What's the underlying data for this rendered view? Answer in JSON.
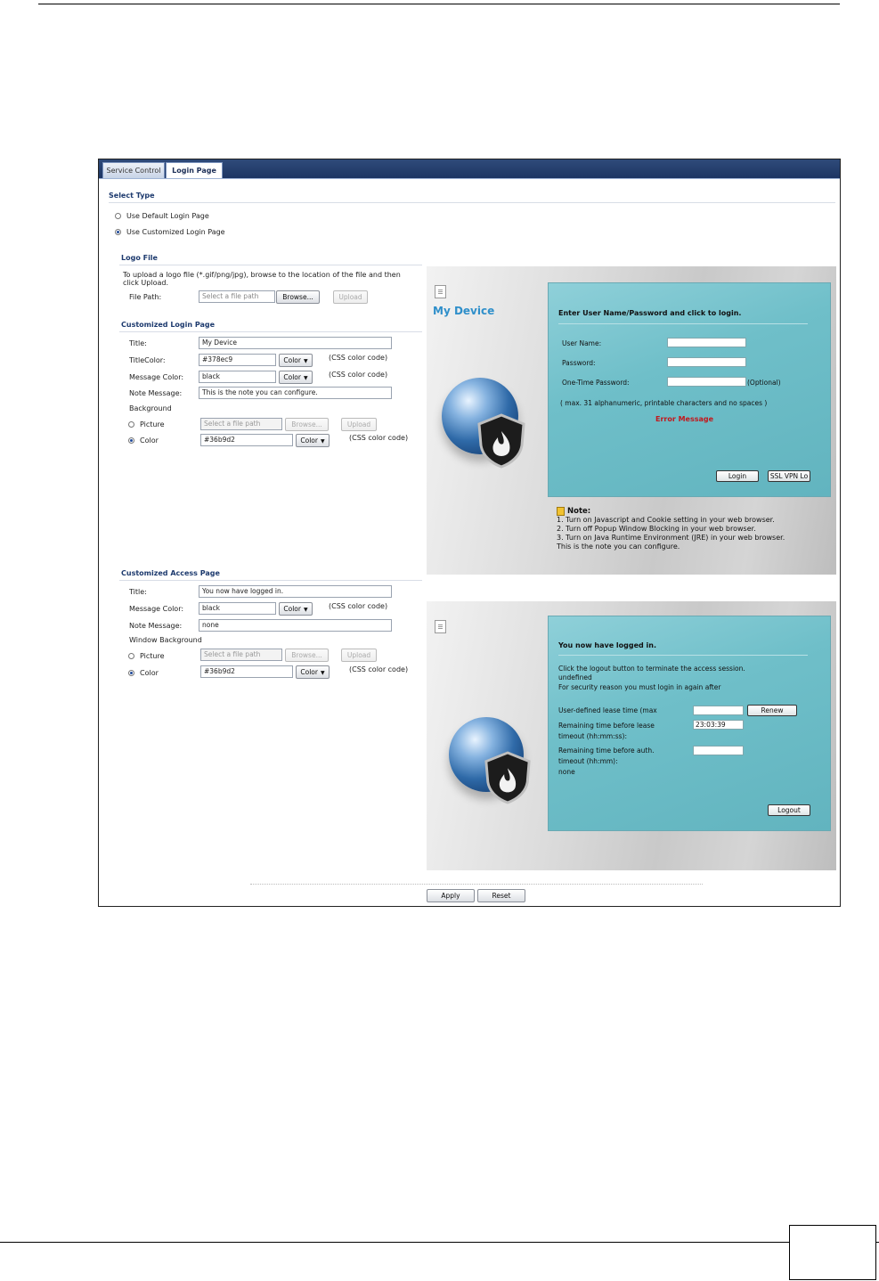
{
  "tabs": [
    {
      "label": "Service Control"
    },
    {
      "label": "Login Page"
    }
  ],
  "select_type": {
    "title": "Select Type",
    "options": [
      "Use Default Login Page",
      "Use Customized Login Page"
    ]
  },
  "logo_file": {
    "title": "Logo File",
    "instruction_line1": "To upload a logo file (*.gif/png/jpg), browse to the location of the file and then",
    "instruction_line2": "click Upload.",
    "file_path_label": "File Path:",
    "file_path_placeholder": "Select a file path",
    "browse": "Browse...",
    "upload": "Upload"
  },
  "login_page": {
    "title": "Customized Login Page",
    "title_label": "Title:",
    "title_value": "My Device",
    "title_color_label": "TitleColor:",
    "title_color_value": "#378ec9",
    "message_color_label": "Message Color:",
    "message_color_value": "black",
    "note_message_label": "Note Message:",
    "note_message_value": "This is the note you can configure.",
    "background_label": "Background",
    "picture_label": "Picture",
    "color_label": "Color",
    "picture_placeholder": "Select a file path",
    "bg_color_value": "#36b9d2",
    "color_button": "Color",
    "css_hint": "(CSS color code)",
    "browse": "Browse...",
    "upload": "Upload"
  },
  "access_page": {
    "title": "Customized Access Page",
    "title_label": "Title:",
    "title_value": "You now have logged in.",
    "message_color_label": "Message Color:",
    "message_color_value": "black",
    "note_message_label": "Note Message:",
    "note_message_value": "none",
    "window_bg_label": "Window Background",
    "picture_label": "Picture",
    "color_label": "Color",
    "picture_placeholder": "Select a file path",
    "bg_color_value": "#36b9d2",
    "color_button": "Color",
    "css_hint": "(CSS color code)",
    "browse": "Browse...",
    "upload": "Upload"
  },
  "login_preview": {
    "device_title": "My Device",
    "heading": "Enter User Name/Password and click to login.",
    "user_name": "User Name:",
    "password": "Password:",
    "otp": "One-Time Password:",
    "optional": "(Optional)",
    "hint": "( max. 31 alphanumeric, printable characters and no spaces )",
    "error": "Error Message",
    "login_btn": "Login",
    "ssl_btn": "SSL VPN Lo",
    "note_title": "Note:",
    "notes": [
      "1. Turn on Javascript and Cookie setting in your web browser.",
      "2. Turn off Popup Window Blocking in your web browser.",
      "3. Turn on Java Runtime Environment (JRE) in your web browser.",
      "This is the note you can configure."
    ]
  },
  "access_preview": {
    "heading": "You now have logged in.",
    "line1": "Click the logout button to terminate the access session.",
    "line2": "undefined",
    "line3": "For security reason you must login in again after",
    "lease_label": "User-defined lease time (max",
    "renew_btn": "Renew",
    "remaining_lease_l1": "Remaining time before lease",
    "remaining_lease_l2": "timeout (hh:mm:ss):",
    "remaining_lease_value": "23:03:39",
    "remaining_auth_l1": "Remaining time before auth.",
    "remaining_auth_l2": "timeout (hh:mm):",
    "remaining_auth_value": "none",
    "logout_btn": "Logout"
  },
  "footer": {
    "apply": "Apply",
    "reset": "Reset"
  },
  "colors": {
    "tab_bar": "#1d3563",
    "section_title": "#1d3a6e",
    "panel": "#6fbfc9",
    "device_title": "#2f8fca",
    "error": "#c1181d"
  }
}
